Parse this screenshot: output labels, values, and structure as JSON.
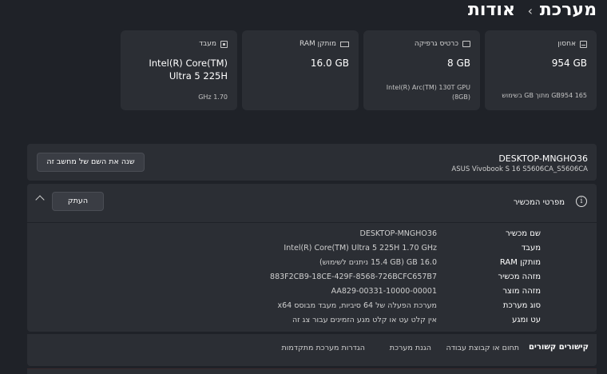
{
  "breadcrumb": {
    "parent": "מערכת",
    "separator": "›",
    "current": "אודות"
  },
  "cards": {
    "storage": {
      "title": "אחסון",
      "value": "954 GB",
      "sub": "165 GB954 מתוך GB בשימוש",
      "icon": "storage-icon"
    },
    "graphics": {
      "title": "כרטיס גרפיקה",
      "value": "8 GB",
      "sub": "Intel(R) Arc(TM) 130T GPU (8GB)",
      "icon": "graphics-card-icon"
    },
    "ram": {
      "title": "מותקן RAM",
      "value": "16.0 GB",
      "sub": "",
      "icon": "ram-icon"
    },
    "cpu": {
      "title": "מעבד",
      "value": "Intel(R) Core(TM) Ultra 5 225H",
      "sub": "1.70 GHz",
      "icon": "cpu-icon"
    }
  },
  "device": {
    "name": "DESKTOP-MNGHO36",
    "model": "ASUS Vivobook S 16 S5606CA_S5606CA",
    "rename_label": "שנה את השם של מחשב זה"
  },
  "specs": {
    "title": "מפרטי המכשיר",
    "copy_label": "העתק",
    "rows": [
      {
        "label": "שם מכשיר",
        "value": "DESKTOP-MNGHO36"
      },
      {
        "label": "מעבד",
        "value": "Intel(R) Core(TM) Ultra 5 225H   1.70 GHz"
      },
      {
        "label": "מותקן RAM",
        "value": "16.0 GB (15.4 GB ניתנים לשימוש)"
      },
      {
        "label": "מזהה מכשיר",
        "value": "883F2CB9-18CE-429F-8568-726BCFC657B7"
      },
      {
        "label": "מזהה מוצר",
        "value": "00331-10000-00001-AA829"
      },
      {
        "label": "סוג מערכת",
        "value": "מערכת הפעלה של 64 סיביות, מעבד מבוסס x64"
      },
      {
        "label": "עט ומגע",
        "value": "אין קלט עט או קלט מגע הזמינים עבור צג זה"
      }
    ]
  },
  "related": {
    "title": "קישורים קשורים",
    "links": [
      "תחום או קבוצת עבודה",
      "הגנת מערכת",
      "הגדרות מערכת מתקדמות"
    ]
  },
  "colors": {
    "background": "#1f2228",
    "card": "#2b2e34",
    "button": "#3a3d44"
  }
}
